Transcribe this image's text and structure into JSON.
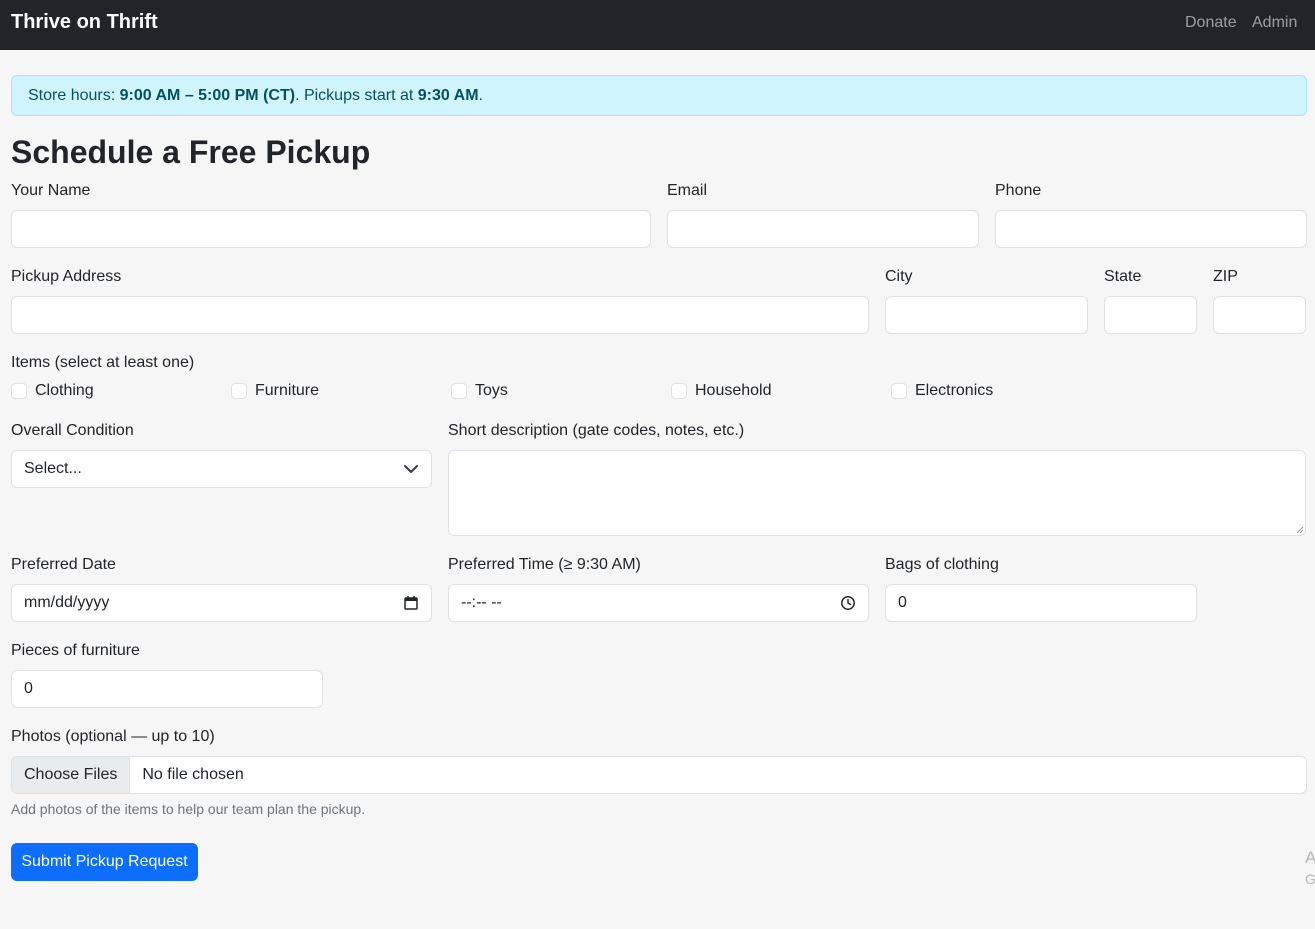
{
  "nav": {
    "brand": "Thrive on Thrift",
    "links": [
      "Donate",
      "Admin"
    ]
  },
  "alert": {
    "prefix": "Store hours: ",
    "hours": "9:00 AM – 5:00 PM (CT)",
    "middle": ". Pickups start at ",
    "pickup_start": "9:30 AM",
    "suffix": "."
  },
  "title": "Schedule a Free Pickup",
  "fields": {
    "name": {
      "label": "Your Name",
      "value": ""
    },
    "email": {
      "label": "Email",
      "value": ""
    },
    "phone": {
      "label": "Phone",
      "value": ""
    },
    "address": {
      "label": "Pickup Address",
      "value": ""
    },
    "city": {
      "label": "City",
      "value": ""
    },
    "state": {
      "label": "State",
      "value": ""
    },
    "zip": {
      "label": "ZIP",
      "value": ""
    },
    "condition": {
      "label": "Overall Condition",
      "value": "Select..."
    },
    "description": {
      "label": "Short description (gate codes, notes, etc.)",
      "value": ""
    },
    "date": {
      "label": "Preferred Date",
      "value": "mm/dd/yyyy"
    },
    "time": {
      "label": "Preferred Time (≥ 9:30 AM)",
      "value": "--:-- --"
    },
    "bags": {
      "label": "Bags of clothing",
      "value": "0"
    },
    "furniture": {
      "label": "Pieces of furniture",
      "value": "0"
    }
  },
  "items": {
    "label": "Items (select at least one)",
    "options": [
      "Clothing",
      "Furniture",
      "Toys",
      "Household",
      "Electronics"
    ]
  },
  "photos": {
    "label": "Photos (optional — up to 10)",
    "button": "Choose Files",
    "status": "No file chosen",
    "help": "Add photos of the items to help our team plan the pickup."
  },
  "submit_label": "Submit Pickup Request",
  "edge_glyphs": [
    "A",
    "G"
  ],
  "icons": {
    "select": "chevron-down-icon",
    "date": "calendar-icon",
    "time": "clock-icon"
  },
  "colors": {
    "navbar": "#212529",
    "alert_bg": "#cff4fc",
    "alert_text": "#055160",
    "primary": "#0d6efd",
    "page_bg": "#f6f6f6"
  }
}
